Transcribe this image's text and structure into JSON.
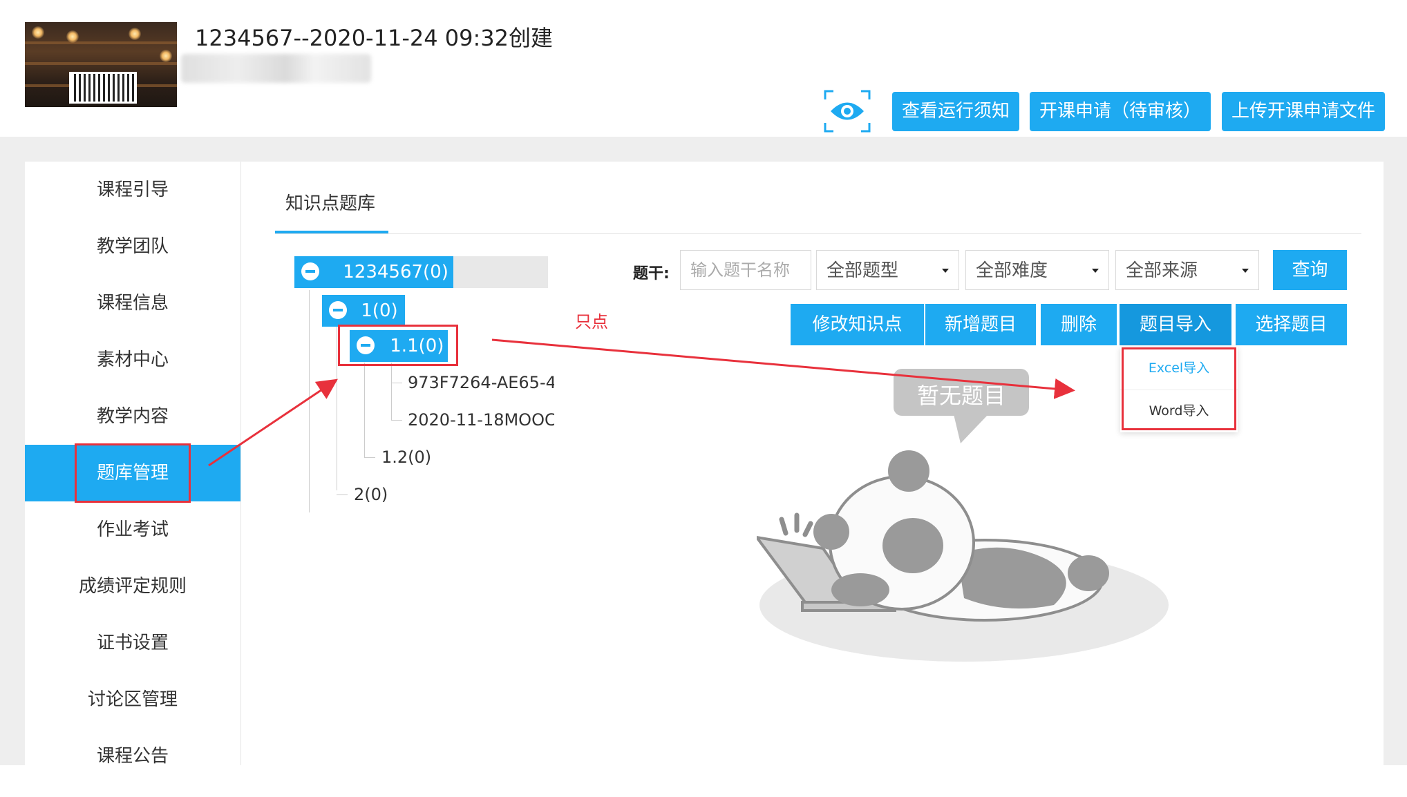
{
  "header": {
    "course_title": "1234567--2020-11-24 09:32创建",
    "buttons": {
      "view_notes": "查看运行须知",
      "course_apply": "开课申请（待审核）",
      "upload_apply_file": "上传开课申请文件"
    }
  },
  "sidebar": {
    "items": [
      {
        "label": "课程引导"
      },
      {
        "label": "教学团队"
      },
      {
        "label": "课程信息"
      },
      {
        "label": "素材中心"
      },
      {
        "label": "教学内容"
      },
      {
        "label": "题库管理"
      },
      {
        "label": "作业考试"
      },
      {
        "label": "成绩评定规则"
      },
      {
        "label": "证书设置"
      },
      {
        "label": "讨论区管理"
      },
      {
        "label": "课程公告"
      }
    ],
    "active": "题库管理"
  },
  "tab": {
    "label": "知识点题库"
  },
  "tree": {
    "root": "1234567(0)",
    "node_1": "1(0)",
    "node_1_1": "1.1(0)",
    "leaf_a": "973F7264-AE65-4",
    "leaf_b": "2020-11-18MOOC,",
    "node_1_2": "1.2(0)",
    "node_2": "2(0)"
  },
  "filters": {
    "stem_label": "题干:",
    "stem_placeholder": "输入题干名称",
    "type_select": "全部题型",
    "difficulty_select": "全部难度",
    "source_select": "全部来源",
    "query_button": "查询"
  },
  "actions": {
    "edit_point": "修改知识点",
    "add_question": "新增题目",
    "delete": "删除",
    "import": "题目导入",
    "select": "选择题目"
  },
  "import_menu": {
    "excel": "Excel导入",
    "word": "Word导入"
  },
  "empty_state": {
    "text": "暂无题目"
  },
  "annotation": {
    "note": "只点"
  },
  "colors": {
    "primary": "#1eaaf1",
    "annotation_red": "#e8313c"
  }
}
